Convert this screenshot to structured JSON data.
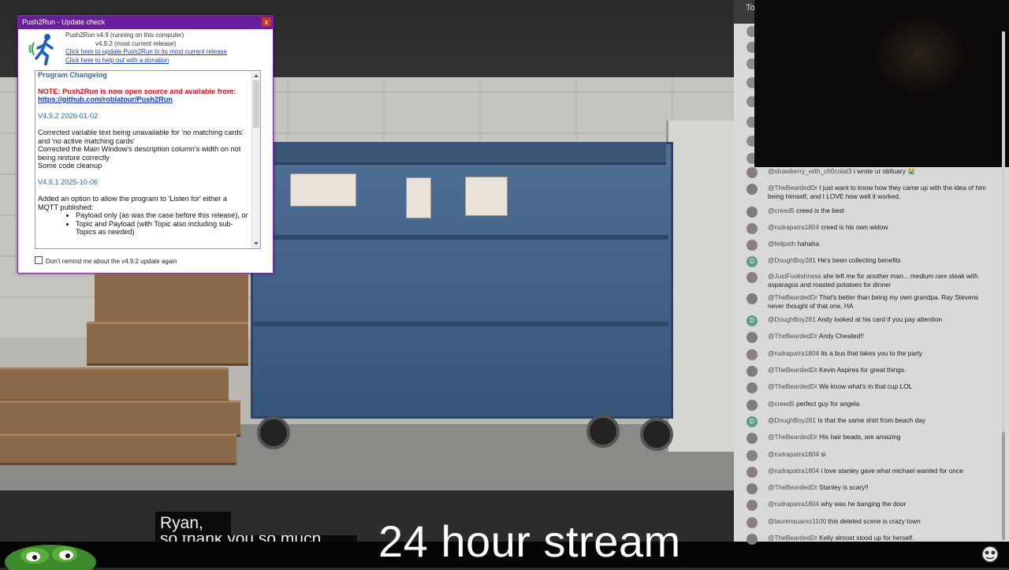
{
  "dialog": {
    "title": "Push2Run - Update check",
    "close_label": "x",
    "version_running": "Push2Run v4.9 (running on this computer)",
    "version_current": "v4.9.2 (most current release)",
    "update_link": "Click here to update Push2Run to its most current release",
    "donate_link": "Click here to help out with a donation",
    "changelog": {
      "heading": "Program Changelog",
      "note": "NOTE: Push2Run is now open source and available from:",
      "url": "https://github.com/roblatour/Push2Run",
      "v1_label": "V4.9.2 2026-01-02",
      "v1_line1": "Corrected variable text being unavailable for 'no matching cards' and 'no active matching cards'",
      "v1_line2": "Corrected the Main Window's description column's width on not being restore correctly",
      "v1_line3": "Some code cleanup",
      "v2_label": "V4.9.1 2025-10-06",
      "v2_line1": "Added an option to allow the program to 'Listen for' either a MQTT published:",
      "v2_bullet1": "Payload only (as was the case before this release), or",
      "v2_bullet2": "Topic and Payload (with Topic also including sub-Topics as needed)"
    },
    "remind_label": "Don't remind me about the v4.9.2 update again"
  },
  "video": {
    "caption_line1": "Ryan,",
    "caption_line2": "so thank you so much",
    "overlay_title": "24 hour stream"
  },
  "chat": {
    "header": "To",
    "messages": [
      {
        "name": "@strawberry_with_ch0colat3",
        "text": "i wrote ur obituary 😭",
        "avatar": "g"
      },
      {
        "name": "@TheBeardedDr",
        "text": "I just want to know how they came up with the idea of him being himself, and I LOVE how well it worked.",
        "avatar": "p"
      },
      {
        "name": "@creed5",
        "text": "creed is the best",
        "avatar": "p"
      },
      {
        "name": "@rudrapatra1804",
        "text": "creed is his own widow",
        "avatar": "g"
      },
      {
        "name": "@fellpath",
        "text": "hahaha",
        "avatar": "g"
      },
      {
        "name": "@DoughBoy281",
        "text": "He's been collecting benefits",
        "avatar": "D"
      },
      {
        "name": "@JustFoolishness",
        "text": "she left me for another man... medium rare steak with asparagus and roasted potatoes for dinner",
        "avatar": "g"
      },
      {
        "name": "@TheBeardedDr",
        "text": "That's better than being my own grandpa. Ray Stevens never thought of that one, HA",
        "avatar": "p"
      },
      {
        "name": "@DoughBoy281",
        "text": "Andy looked at his card if you pay attention",
        "avatar": "D"
      },
      {
        "name": "@TheBeardedDr",
        "text": "Andy Cheated!!",
        "avatar": "p"
      },
      {
        "name": "@rudrapatra1804",
        "text": "its a bus that takes you to the party",
        "avatar": "g"
      },
      {
        "name": "@TheBeardedDr",
        "text": "Kevin Aspires for great things.",
        "avatar": "p"
      },
      {
        "name": "@TheBeardedDr",
        "text": "We know what's in that cup LOL",
        "avatar": "p"
      },
      {
        "name": "@creed5",
        "text": "perfect guy for angela",
        "avatar": "p"
      },
      {
        "name": "@DoughBoy281",
        "text": "Is that the same shirt from beach day",
        "avatar": "D"
      },
      {
        "name": "@TheBeardedDr",
        "text": "His hair beads, are amazing",
        "avatar": "p"
      },
      {
        "name": "@rudrapatra1804",
        "text": "si",
        "avatar": "g"
      },
      {
        "name": "@rudrapatra1804",
        "text": "i love stanley gave what michael wanted for once",
        "avatar": "g"
      },
      {
        "name": "@TheBeardedDr",
        "text": "Stanley is scary!!",
        "avatar": "p"
      },
      {
        "name": "@rudrapatra1804",
        "text": "why was he banging the door",
        "avatar": "g"
      },
      {
        "name": "@laurensuarez1100",
        "text": "this deleted scene is crazy town",
        "avatar": "g"
      },
      {
        "name": "@TheBeardedDr",
        "text": "Kelly almost stood up for herself.",
        "avatar": "p"
      }
    ]
  },
  "colors": {
    "dialog_titlebar": "#6a1f9a",
    "changelog_heading": "#2c6aa8",
    "note_red": "#d2121f",
    "link_blue": "#1a3fb0",
    "chat_bg": "#d9d9d9"
  }
}
